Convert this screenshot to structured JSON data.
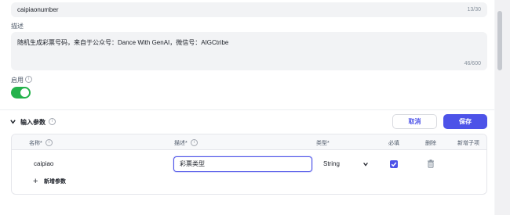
{
  "plugin_name": {
    "value": "caipiaonumber",
    "counter": "13/30"
  },
  "description": {
    "label": "描述",
    "value": "随机生成彩票号码，来自于公众号：Dance With GenAI，微信号：AIGCtribe",
    "counter": "46/600"
  },
  "enable": {
    "label": "启用",
    "on": true
  },
  "input_params": {
    "title": "输入参数",
    "cancel_label": "取消",
    "save_label": "保存",
    "columns": {
      "name": "名称*",
      "desc": "描述*",
      "type": "类型*",
      "required": "必填",
      "delete": "删除",
      "add_child": "新增子项"
    },
    "rows": [
      {
        "name": "caipiao",
        "desc": "彩票类型",
        "type": "String",
        "required": true
      }
    ],
    "add_param_label": "新增参数"
  },
  "colors": {
    "accent": "#4d53e8",
    "toggle_on": "#24b24b",
    "field_bg": "#f2f3f5"
  },
  "icons": [
    "info-icon",
    "chevron-down-icon",
    "checkbox-icon",
    "trash-icon",
    "plus-icon"
  ]
}
